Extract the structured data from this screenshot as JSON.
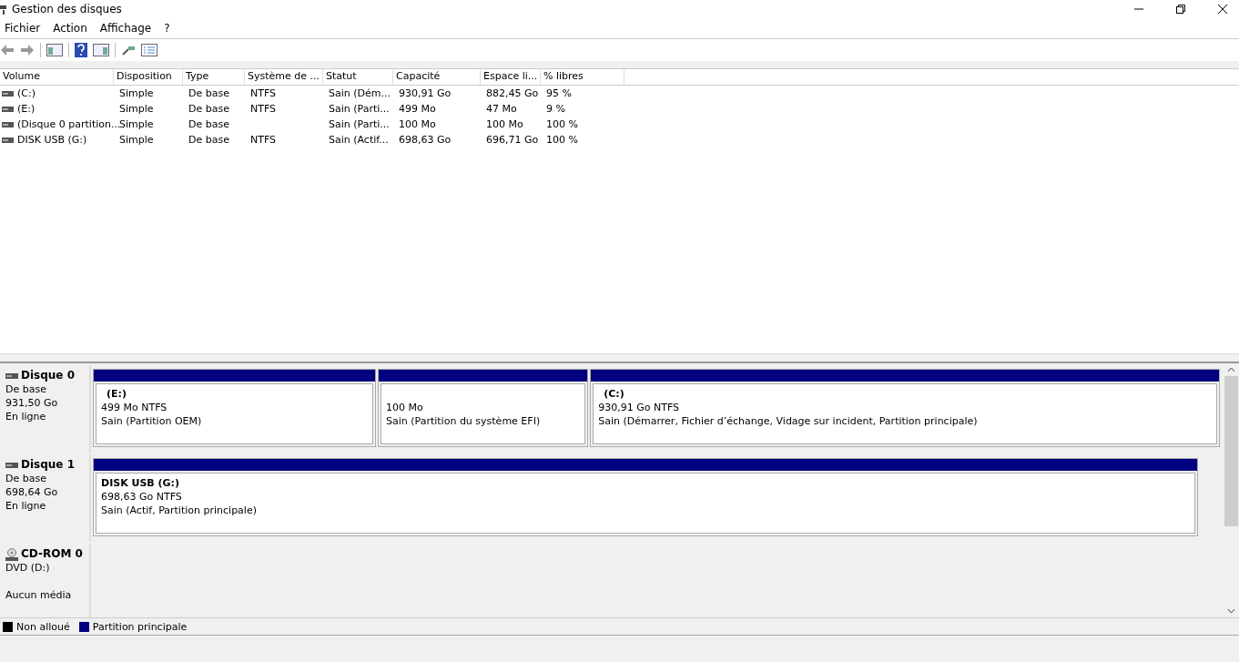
{
  "window": {
    "title": "Gestion des disques"
  },
  "menu": [
    "Fichier",
    "Action",
    "Affichage",
    "?"
  ],
  "table": {
    "columns": [
      "Volume",
      "Disposition",
      "Type",
      "Système de ...",
      "Statut",
      "Capacité",
      "Espace li...",
      "% libres"
    ],
    "rows": [
      [
        "(C:)",
        "Simple",
        "De base",
        "NTFS",
        "Sain (Dém...",
        "930,91 Go",
        "882,45 Go",
        "95 %"
      ],
      [
        "(E:)",
        "Simple",
        "De base",
        "NTFS",
        "Sain (Parti...",
        "499 Mo",
        "47 Mo",
        "9 %"
      ],
      [
        "(Disque 0 partition...",
        "Simple",
        "De base",
        "",
        "Sain (Parti...",
        "100 Mo",
        "100 Mo",
        "100 %"
      ],
      [
        "DISK USB (G:)",
        "Simple",
        "De base",
        "NTFS",
        "Sain (Actif...",
        "698,63 Go",
        "696,71 Go",
        "100 %"
      ]
    ]
  },
  "disks": [
    {
      "name": "Disque 0",
      "kind": "disk",
      "lines": [
        "De base",
        "931,50 Go",
        "En ligne"
      ],
      "partitions": [
        {
          "label": "(E:)",
          "size": "499 Mo NTFS",
          "status": "Sain (Partition OEM)"
        },
        {
          "size": "100 Mo",
          "status": "Sain (Partition du système EFI)"
        },
        {
          "label": "(C:)",
          "size": "930,91 Go NTFS",
          "status": "Sain (Démarrer, Fichier d’échange, Vidage sur incident, Partition principale)"
        }
      ]
    },
    {
      "name": "Disque 1",
      "kind": "disk",
      "lines": [
        "De base",
        "698,64 Go",
        "En ligne"
      ],
      "partitions": [
        {
          "label": "DISK USB  (G:)",
          "size": "698,63 Go NTFS",
          "status": "Sain (Actif, Partition principale)"
        }
      ]
    },
    {
      "name": "CD-ROM 0",
      "kind": "cdrom",
      "lines": [
        "DVD (D:)"
      ],
      "media": "Aucun média"
    }
  ],
  "legend": [
    {
      "label": "Non alloué",
      "color": "#000000"
    },
    {
      "label": "Partition principale",
      "color": "#000080"
    }
  ]
}
